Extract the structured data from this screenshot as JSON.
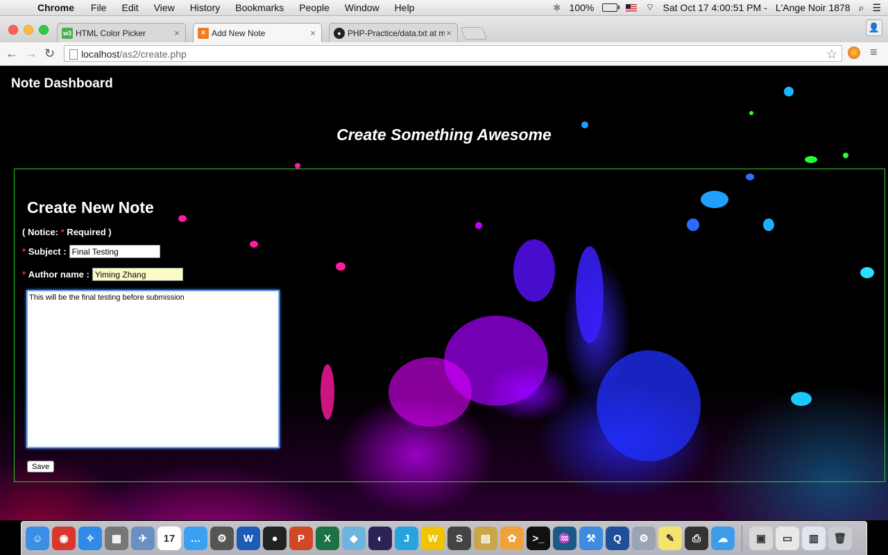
{
  "menubar": {
    "app_name": "Chrome",
    "items": [
      "File",
      "Edit",
      "View",
      "History",
      "Bookmarks",
      "People",
      "Window",
      "Help"
    ],
    "battery": "100%",
    "datetime": "Sat Oct 17  4:00:51 PM",
    "user": "L'Ange Noir 1878"
  },
  "tabs": [
    {
      "title": "HTML Color Picker",
      "favicon": "w3"
    },
    {
      "title": "Add New Note",
      "favicon": "xampp"
    },
    {
      "title": "PHP-Practice/data.txt at m",
      "favicon": "github"
    }
  ],
  "address": {
    "host": "localhost",
    "path": "/as2/create.php"
  },
  "page": {
    "dashboard_title": "Note Dashboard",
    "hero_title": "Create Something Awesome",
    "form": {
      "heading": "Create New Note",
      "notice_prefix": "( Notice: ",
      "notice_star": "*",
      "notice_suffix": " Required )",
      "required_marker": "*",
      "subject_label": "Subject :",
      "subject_value": "Final Testing",
      "author_label": "Author name :",
      "author_value": "Yiming Zhang",
      "content_value": "This will be the final testing before submission",
      "save_label": "Save"
    }
  },
  "dock": {
    "apps": [
      {
        "name": "finder",
        "glyph": "☺",
        "color": "#3a8ee6"
      },
      {
        "name": "chrome",
        "glyph": "◉",
        "color": "#d8382b"
      },
      {
        "name": "safari",
        "glyph": "✧",
        "color": "#2f8ae8"
      },
      {
        "name": "calculator",
        "glyph": "▦",
        "color": "#777777"
      },
      {
        "name": "preview",
        "glyph": "✈",
        "color": "#6a8fc0"
      },
      {
        "name": "calendar",
        "glyph": "17",
        "color": "#ffffff"
      },
      {
        "name": "messages",
        "glyph": "…",
        "color": "#3ba0f0"
      },
      {
        "name": "system-preferences",
        "glyph": "⚙",
        "color": "#555555"
      },
      {
        "name": "word",
        "glyph": "W",
        "color": "#1e5bb5"
      },
      {
        "name": "qq",
        "glyph": "●",
        "color": "#222222"
      },
      {
        "name": "powerpoint",
        "glyph": "P",
        "color": "#d24726"
      },
      {
        "name": "excel",
        "glyph": "X",
        "color": "#1e7145"
      },
      {
        "name": "cube-app",
        "glyph": "◆",
        "color": "#6fb3e0"
      },
      {
        "name": "eclipse",
        "glyph": "◐",
        "color": "#2c2255"
      },
      {
        "name": "jetbrains",
        "glyph": "J",
        "color": "#29a3e0"
      },
      {
        "name": "wps",
        "glyph": "W",
        "color": "#f0c400"
      },
      {
        "name": "sublime-text",
        "glyph": "S",
        "color": "#444444"
      },
      {
        "name": "archive-utility",
        "glyph": "▤",
        "color": "#c9a64a"
      },
      {
        "name": "photos",
        "glyph": "✿",
        "color": "#f1a33b"
      },
      {
        "name": "terminal",
        "glyph": ">_",
        "color": "#111111"
      },
      {
        "name": "mysql-workbench",
        "glyph": "♒",
        "color": "#1a5b86"
      },
      {
        "name": "xcode",
        "glyph": "⚒",
        "color": "#3e8be0"
      },
      {
        "name": "quicktime",
        "glyph": "Q",
        "color": "#1f4e9a"
      },
      {
        "name": "disk-utility",
        "glyph": "⚙",
        "color": "#9aa4b2"
      },
      {
        "name": "stickies",
        "glyph": "✎",
        "color": "#f3e46d"
      },
      {
        "name": "printer",
        "glyph": "⎙",
        "color": "#333333"
      },
      {
        "name": "icloud",
        "glyph": "☁",
        "color": "#3d9be9"
      }
    ],
    "stacks": [
      {
        "name": "archive-stack",
        "glyph": "▣",
        "color": "#d8d8d8"
      },
      {
        "name": "documents-stack",
        "glyph": "▭",
        "color": "#e8e8e8"
      },
      {
        "name": "downloads-stack",
        "glyph": "▥",
        "color": "#dfe6ef"
      },
      {
        "name": "trash",
        "glyph": "🗑",
        "color": "#c9ccd0"
      }
    ]
  }
}
